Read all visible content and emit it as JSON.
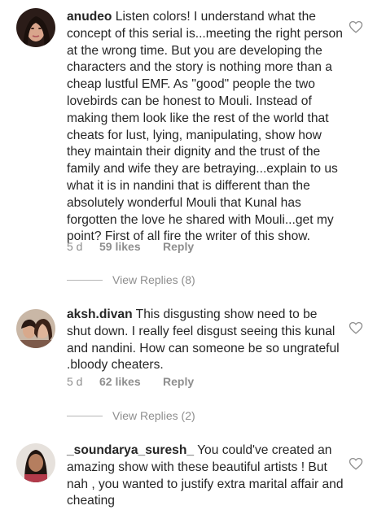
{
  "comments": [
    {
      "username": "anudeo",
      "text": "Listen colors! I understand what the concept of this serial is...meeting the right person at the wrong time. But you are developing the characters and the story is nothing more than a cheap lustful EMF. As \"good\" people the two lovebirds can be honest to Mouli. Instead of making them look like the rest of the world that cheats for lust, lying, manipulating, show how they maintain their dignity and the trust of the family and wife they are betraying...explain to us what it is in nandini that is different than the absolutely wonderful Mouli that Kunal has forgotten the love he shared with Mouli...get my point? First of all fire the writer of this show.",
      "time": "5 d",
      "likes": "59 likes",
      "reply": "Reply",
      "view_replies": "View Replies (8)"
    },
    {
      "username": "aksh.divan",
      "text": "This disgusting show need to be shut down. I really feel disgust seeing this kunal and nandini. How can someone be so ungrateful .bloody cheaters.",
      "time": "5 d",
      "likes": "62 likes",
      "reply": "Reply",
      "view_replies": "View Replies (2)"
    },
    {
      "username": "_soundarya_suresh_",
      "text": "You could've created an amazing show with these beautiful artists ! But nah , you wanted to  justify extra marital affair and cheating"
    }
  ],
  "icons": {
    "like": "heart-outline-icon"
  },
  "colors": {
    "text": "#262626",
    "muted": "#8e8e8e"
  }
}
